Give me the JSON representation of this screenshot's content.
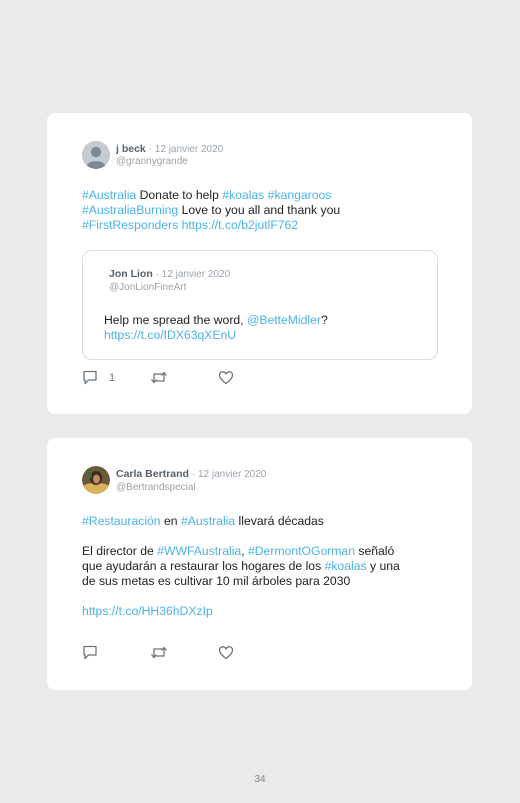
{
  "tweet1": {
    "name": "j beck",
    "date": "· 12 janvier 2020",
    "handle": "@grannygrande",
    "line1": {
      "t1": "#Australia",
      "t2": " Donate to help ",
      "t3": "#koalas",
      "t4": " ",
      "t5": "#kangaroos"
    },
    "line2": {
      "t1": "#AustraliaBurning",
      "t2": " Love to you all and thank you"
    },
    "line3": {
      "t1": "#FirstResponders",
      "t2": " ",
      "t3": "https://t.co/b2jutlF762"
    },
    "quote": {
      "name": "Jon Lion",
      "date": "· 12 janvier 2020",
      "handle": "@JonLionFineArt",
      "line1": {
        "t1": "Help me spread the word, ",
        "t2": "@BetteMidler",
        "t3": "?"
      },
      "line2": "https://t.co/IDX63qXEnU"
    },
    "reply_count": "1"
  },
  "tweet2": {
    "name": "Carla Bertrand",
    "date": "· 12 janvier 2020",
    "handle": "@Bertrandspecial",
    "line1": {
      "t1": "#Restauración",
      "t2": " en ",
      "t3": "#Australia",
      "t4": " llevará décadas"
    },
    "line2": {
      "t1": "El director de ",
      "t2": "#WWFAustralia",
      "t3": ", ",
      "t4": "#DermontOGorman",
      "t5": " señaló"
    },
    "line3": {
      "t1": "que ayudarán a restaurar los hogares de los ",
      "t2": "#koalas",
      "t3": " y una"
    },
    "line4": "de sus metas es cultivar 10 mil árboles para 2030",
    "line5": "https://t.co/HH36hDXzIp",
    "reply_count": ""
  },
  "page_number": "34",
  "colors": {
    "link": "#4ab3e8",
    "background": "#ebeae8",
    "card": "#ffffff"
  },
  "icons": [
    "reply-icon",
    "retweet-icon",
    "like-icon"
  ]
}
